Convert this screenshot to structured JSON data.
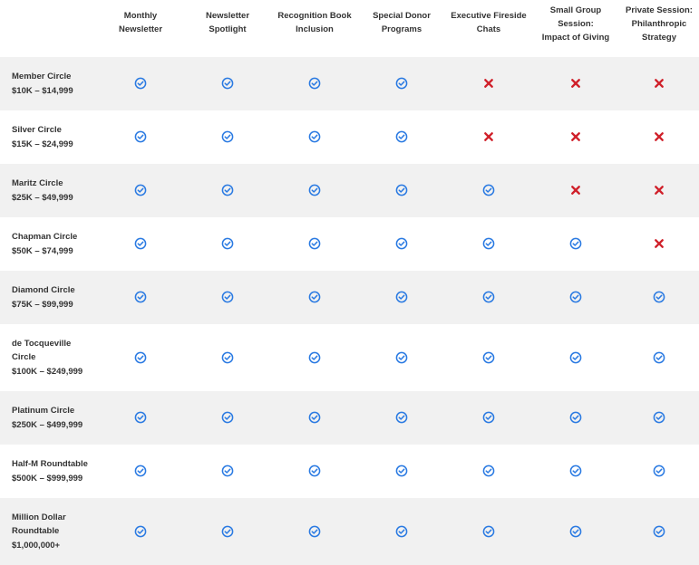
{
  "colors": {
    "check": "#2a7ae2",
    "cross": "#d0202a",
    "shade": "#f1f1f1"
  },
  "columns": [
    {
      "label": "Monthly\nNewsletter"
    },
    {
      "label": "Newsletter\nSpotlight"
    },
    {
      "label": "Recognition Book\nInclusion"
    },
    {
      "label": "Special Donor\nPrograms"
    },
    {
      "label": "Executive Fireside\nChats"
    },
    {
      "label": "Small Group\nSession:\nImpact of Giving"
    },
    {
      "label": "Private Session:\nPhilanthropic\nStrategy"
    }
  ],
  "rows": [
    {
      "name": "Member Circle",
      "range": "$10K – $14,999",
      "benefits": [
        "check-icon",
        "check-icon",
        "check-icon",
        "check-icon",
        "cross-icon",
        "cross-icon",
        "cross-icon"
      ]
    },
    {
      "name": "Silver Circle",
      "range": "$15K – $24,999",
      "benefits": [
        "check-icon",
        "check-icon",
        "check-icon",
        "check-icon",
        "cross-icon",
        "cross-icon",
        "cross-icon"
      ]
    },
    {
      "name": "Maritz Circle",
      "range": "$25K – $49,999",
      "benefits": [
        "check-icon",
        "check-icon",
        "check-icon",
        "check-icon",
        "check-icon",
        "cross-icon",
        "cross-icon"
      ]
    },
    {
      "name": "Chapman Circle",
      "range": "$50K – $74,999",
      "benefits": [
        "check-icon",
        "check-icon",
        "check-icon",
        "check-icon",
        "check-icon",
        "check-icon",
        "cross-icon"
      ]
    },
    {
      "name": "Diamond Circle",
      "range": "$75K – $99,999",
      "benefits": [
        "check-icon",
        "check-icon",
        "check-icon",
        "check-icon",
        "check-icon",
        "check-icon",
        "check-icon"
      ]
    },
    {
      "name": "de Tocqueville\nCircle",
      "range": "$100K – $249,999",
      "benefits": [
        "check-icon",
        "check-icon",
        "check-icon",
        "check-icon",
        "check-icon",
        "check-icon",
        "check-icon"
      ]
    },
    {
      "name": "Platinum Circle",
      "range": "$250K – $499,999",
      "benefits": [
        "check-icon",
        "check-icon",
        "check-icon",
        "check-icon",
        "check-icon",
        "check-icon",
        "check-icon"
      ]
    },
    {
      "name": "Half-M Roundtable",
      "range": "$500K – $999,999",
      "benefits": [
        "check-icon",
        "check-icon",
        "check-icon",
        "check-icon",
        "check-icon",
        "check-icon",
        "check-icon"
      ]
    },
    {
      "name": "Million Dollar\nRoundtable",
      "range": "$1,000,000+",
      "benefits": [
        "check-icon",
        "check-icon",
        "check-icon",
        "check-icon",
        "check-icon",
        "check-icon",
        "check-icon"
      ]
    }
  ]
}
